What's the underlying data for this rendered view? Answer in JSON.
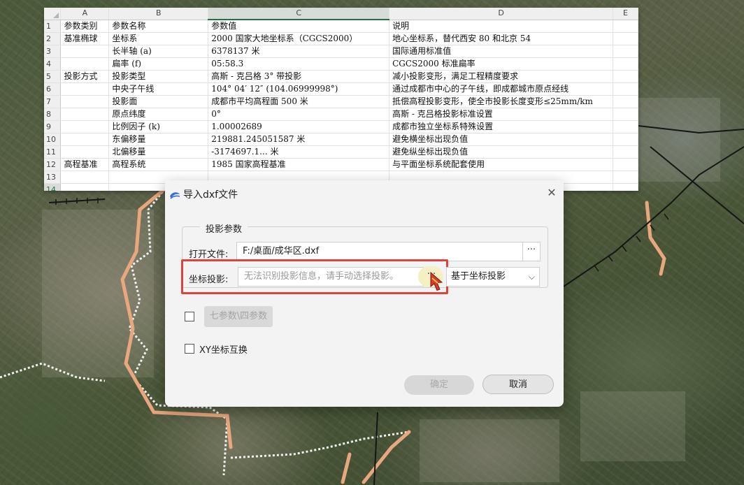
{
  "spreadsheet": {
    "columns": [
      "A",
      "B",
      "C",
      "D",
      "E"
    ],
    "selected_column": "C",
    "active_row": "14",
    "rows": [
      {
        "n": "1",
        "a": "参数类别",
        "b": "参数名称",
        "c": "参数值",
        "d": "说明"
      },
      {
        "n": "2",
        "a": "基准椭球",
        "b": "坐标系",
        "c": "2000 国家大地坐标系（CGCS2000）",
        "d": "地心坐标系，替代西安 80 和北京 54"
      },
      {
        "n": "3",
        "a": "",
        "b": "长半轴 (a)",
        "c": "6378137 米",
        "d": "国际通用标准值"
      },
      {
        "n": "4",
        "a": "",
        "b": "扁率 (f)",
        "c": "05:58.3",
        "d": "CGCS2000 标准扁率"
      },
      {
        "n": "5",
        "a": "投影方式",
        "b": "投影类型",
        "c": "高斯 - 克吕格 3°  带投影",
        "d": "减小投影变形，满足工程精度要求"
      },
      {
        "n": "6",
        "a": "",
        "b": "中央子午线",
        "c": "104° 04′ 12″ (104.06999998°)",
        "d": "通过成都市中心的子午线，即成都城市原点经线"
      },
      {
        "n": "7",
        "a": "",
        "b": "投影面",
        "c": "成都市平均高程面 500 米",
        "d": "抵偿高程投影变形，使全市投影长度变形≤25mm/km"
      },
      {
        "n": "8",
        "a": "",
        "b": "原点纬度",
        "c": "0°",
        "d": "高斯 - 克吕格投影标准设置"
      },
      {
        "n": "9",
        "a": "",
        "b": "比例因子 (k)",
        "c": "1.00002689",
        "d": "成都市独立坐标系特殊设置"
      },
      {
        "n": "10",
        "a": "",
        "b": "东偏移量",
        "c": "219881.245051587 米",
        "d": "避免横坐标出现负值"
      },
      {
        "n": "11",
        "a": "",
        "b": "北偏移量",
        "c": "-3174697.1... 米",
        "d": "避免纵坐标出现负值"
      },
      {
        "n": "12",
        "a": "高程基准",
        "b": "高程系统",
        "c": "1985 国家高程基准",
        "d": "与平面坐标系统配套使用"
      },
      {
        "n": "13",
        "a": "",
        "b": "",
        "c": "",
        "d": ""
      },
      {
        "n": "14",
        "a": "",
        "b": "",
        "c": "",
        "d": ""
      }
    ]
  },
  "dialog": {
    "title": "导入dxf文件",
    "close_glyph": "✕",
    "group_title": "投影参数",
    "open_file_label": "打开文件:",
    "open_file_value": "F:/桌面/成华区.dxf",
    "browse_glyph": "···",
    "projection_label": "坐标投影:",
    "projection_placeholder": "无法识别投影信息，请手动选择投影。",
    "projection_mode": "基于坐标投影",
    "seven_param_label": "七参数\\四参数",
    "seven_param_checked": false,
    "xy_swap_label": "XY坐标互换",
    "xy_swap_checked": false,
    "ok_label": "确定",
    "cancel_label": "取消"
  },
  "colors": {
    "excel_green": "#217346",
    "highlight_red": "#e0433f",
    "road_orange": "#e8a77e"
  }
}
